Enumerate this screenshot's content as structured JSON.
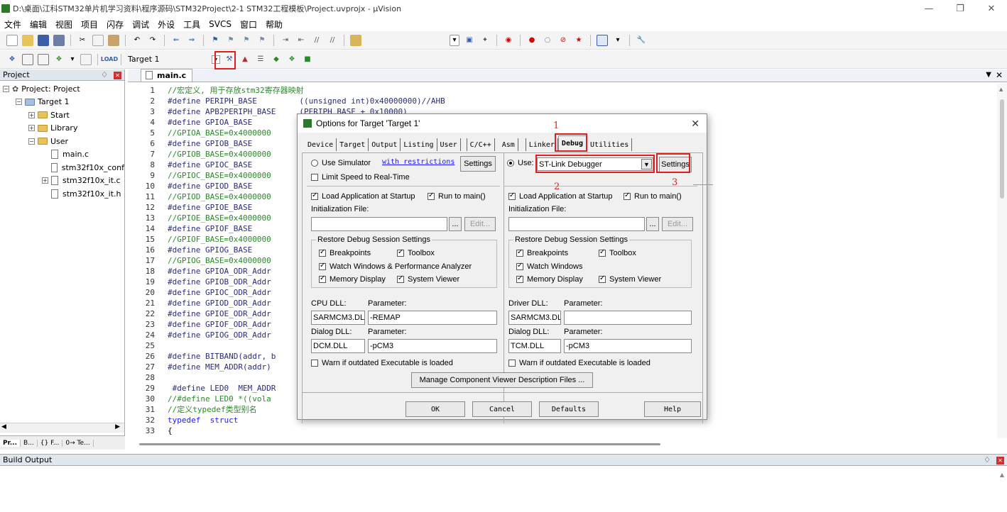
{
  "window": {
    "title": "D:\\桌面\\江科STM32单片机学习资料\\程序源码\\STM32Project\\2-1 STM32工程模板\\Project.uvprojx - µVision"
  },
  "menu": [
    "文件",
    "编辑",
    "视图",
    "项目",
    "闪存",
    "调试",
    "外设",
    "工具",
    "SVCS",
    "窗口",
    "帮助"
  ],
  "toolbar2": {
    "target": "Target 1"
  },
  "project_panel": {
    "title": "Project",
    "root": "Project: Project",
    "target": "Target 1",
    "groups": [
      "Start",
      "Library",
      "User"
    ],
    "files": [
      "main.c",
      "stm32f10x_conf",
      "stm32f10x_it.c",
      "stm32f10x_it.h"
    ],
    "tabs": [
      "Pr...",
      "B...",
      "{} F...",
      "0→ Te..."
    ]
  },
  "editor": {
    "tab": "main.c",
    "lines": [
      {
        "n": "1",
        "t": "//宏定义, 用于存放stm32寄存器映射"
      },
      {
        "n": "2",
        "t": "#define PERIPH_BASE         ((unsigned int)0x40000000)//AHB"
      },
      {
        "n": "3",
        "t": "#define APB2PERIPH_BASE     (PERIPH_BASE + 0x10000)"
      },
      {
        "n": "4",
        "t": "#define GPIOA_BASE"
      },
      {
        "n": "5",
        "t": "//GPIOA_BASE=0x4000000"
      },
      {
        "n": "6",
        "t": "#define GPIOB_BASE"
      },
      {
        "n": "7",
        "t": "//GPIOB_BASE=0x4000000"
      },
      {
        "n": "8",
        "t": "#define GPIOC_BASE"
      },
      {
        "n": "9",
        "t": "//GPIOC_BASE=0x4000000"
      },
      {
        "n": "10",
        "t": "#define GPIOD_BASE"
      },
      {
        "n": "11",
        "t": "//GPIOD_BASE=0x4000000"
      },
      {
        "n": "12",
        "t": "#define GPIOE_BASE"
      },
      {
        "n": "13",
        "t": "//GPIOE_BASE=0x4000000"
      },
      {
        "n": "14",
        "t": "#define GPIOF_BASE"
      },
      {
        "n": "15",
        "t": "//GPIOF_BASE=0x4000000"
      },
      {
        "n": "16",
        "t": "#define GPIOG_BASE"
      },
      {
        "n": "17",
        "t": "//GPIOG_BASE=0x4000000"
      },
      {
        "n": "18",
        "t": "#define GPIOA_ODR_Addr"
      },
      {
        "n": "19",
        "t": "#define GPIOB_ODR_Addr"
      },
      {
        "n": "20",
        "t": "#define GPIOC_ODR_Addr"
      },
      {
        "n": "21",
        "t": "#define GPIOD_ODR_Addr"
      },
      {
        "n": "22",
        "t": "#define GPIOE_ODR_Addr"
      },
      {
        "n": "23",
        "t": "#define GPIOF_ODR_Addr"
      },
      {
        "n": "24",
        "t": "#define GPIOG_ODR_Addr"
      },
      {
        "n": "25",
        "t": ""
      },
      {
        "n": "26",
        "t": "#define BITBAND(addr, b"
      },
      {
        "n": "27",
        "t": "#define MEM_ADDR(addr)"
      },
      {
        "n": "28",
        "t": ""
      },
      {
        "n": "29",
        "t": " #define LED0  MEM_ADDR"
      },
      {
        "n": "30",
        "t": "//#define LED0 *((vola"
      },
      {
        "n": "31",
        "t": "//定义typedef类型别名"
      },
      {
        "n": "32",
        "t": "typedef  struct"
      },
      {
        "n": "33",
        "t": "{"
      }
    ]
  },
  "build_output": {
    "title": "Build Output"
  },
  "dialog": {
    "title": "Options for Target 'Target 1'",
    "tabs": [
      "Device",
      "Target",
      "Output",
      "Listing",
      "User",
      "C/C++",
      "Asm",
      "Linker",
      "Debug",
      "Utilities"
    ],
    "left": {
      "use_simulator": "Use Simulator",
      "with_restrictions": "with restrictions",
      "settings": "Settings",
      "limit_speed": "Limit Speed to Real-Time",
      "load_app": "Load Application at Startup",
      "run_to_main": "Run to main()",
      "init_file": "Initialization File:",
      "edit": "Edit...",
      "restore": "Restore Debug Session Settings",
      "breakpoints": "Breakpoints",
      "toolbox": "Toolbox",
      "watch": "Watch Windows & Performance Analyzer",
      "memory": "Memory Display",
      "sysviewer": "System Viewer",
      "cpu_dll_label": "CPU DLL:",
      "param_label": "Parameter:",
      "cpu_dll": "SARMCM3.DLL",
      "cpu_param": "-REMAP",
      "dialog_dll_label": "Dialog DLL:",
      "dialog_dll": "DCM.DLL",
      "dialog_param": "-pCM3",
      "warn": "Warn if outdated Executable is loaded"
    },
    "right": {
      "use": "Use:",
      "debugger": "ST-Link Debugger",
      "settings": "Settings",
      "load_app": "Load Application at Startup",
      "run_to_main": "Run to main()",
      "init_file": "Initialization File:",
      "edit": "Edit...",
      "restore": "Restore Debug Session Settings",
      "breakpoints": "Breakpoints",
      "toolbox": "Toolbox",
      "watch": "Watch Windows",
      "memory": "Memory Display",
      "sysviewer": "System Viewer",
      "driver_dll_label": "Driver DLL:",
      "param_label": "Parameter:",
      "driver_dll": "SARMCM3.DLL",
      "driver_param": "",
      "dialog_dll_label": "Dialog DLL:",
      "dialog_dll": "TCM.DLL",
      "dialog_param": "-pCM3",
      "warn": "Warn if outdated Executable is loaded"
    },
    "manage": "Manage Component Viewer Description Files ...",
    "ok": "OK",
    "cancel": "Cancel",
    "defaults": "Defaults",
    "help": "Help"
  },
  "annotations": {
    "n1": "1",
    "n2": "2",
    "n3": "3",
    "color": "#e02020"
  }
}
